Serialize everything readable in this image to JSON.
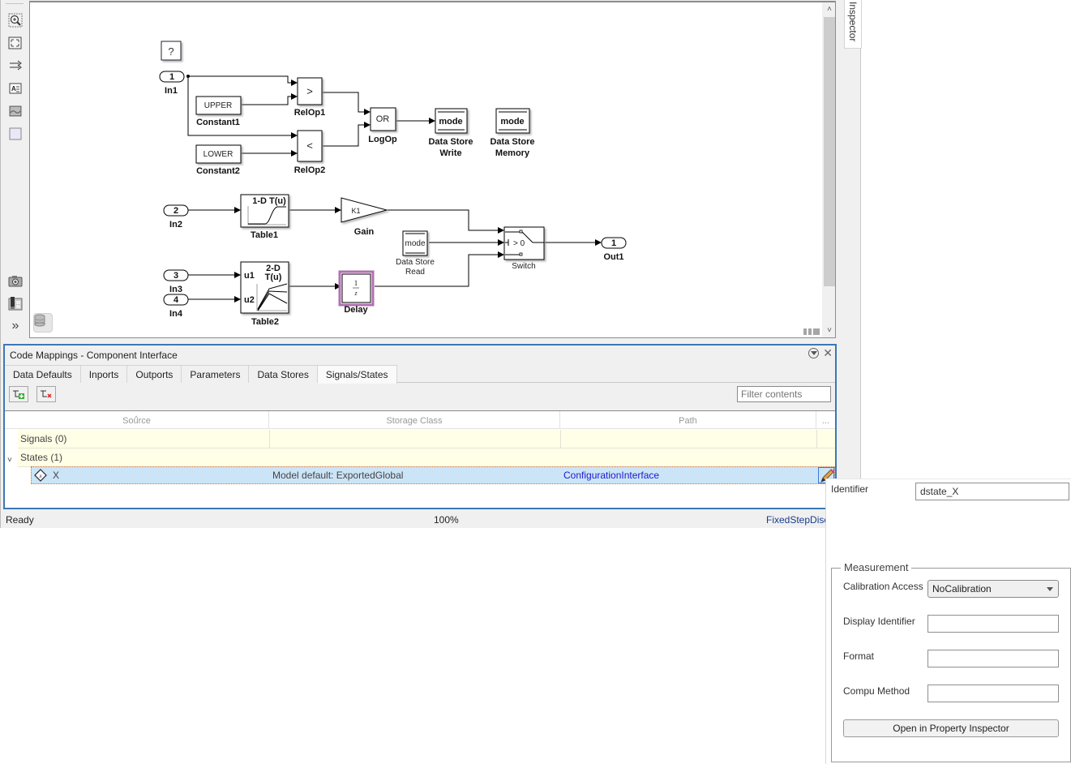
{
  "canvas": {
    "blocks": {
      "help": "?",
      "in1": {
        "num": "1",
        "label": "In1"
      },
      "in2": {
        "num": "2",
        "label": "In2"
      },
      "in3": {
        "num": "3",
        "label": "In3"
      },
      "in4": {
        "num": "4",
        "label": "In4"
      },
      "constant1": {
        "value": "UPPER",
        "label": "Constant1"
      },
      "constant2": {
        "value": "LOWER",
        "label": "Constant2"
      },
      "relop1": {
        "op": ">",
        "label": "RelOp1"
      },
      "relop2": {
        "op": "<",
        "label": "RelOp2"
      },
      "logop": {
        "op": "OR",
        "label": "LogOp"
      },
      "ds_write": {
        "name": "mode",
        "label_line1": "Data Store",
        "label_line2": "Write"
      },
      "ds_memory": {
        "name": "mode",
        "label_line1": "Data Store",
        "label_line2": "Memory"
      },
      "table1": {
        "title": "1-D T(u)",
        "label": "Table1"
      },
      "gain": {
        "value": "K1",
        "label": "Gain"
      },
      "ds_read": {
        "name": "mode",
        "label_line1": "Data Store",
        "label_line2": "Read"
      },
      "switch": {
        "criteria": "> 0",
        "label": "Switch"
      },
      "out1": {
        "num": "1",
        "label": "Out1"
      },
      "table2": {
        "title_line1": "2-D",
        "title_line2": "T(u)",
        "port1": "u1",
        "port2": "u2",
        "label": "Table2"
      },
      "delay": {
        "num": "1",
        "den": "z",
        "label": "Delay"
      }
    }
  },
  "inspector_tab": "Inspector",
  "code_mappings": {
    "title": "Code Mappings - Component Interface",
    "tabs": [
      "Data Defaults",
      "Inports",
      "Outports",
      "Parameters",
      "Data Stores",
      "Signals/States"
    ],
    "active_tab": "Signals/States",
    "filter_placeholder": "Filter contents",
    "columns": [
      "Source",
      "Storage Class",
      "Path",
      "..."
    ],
    "groups": [
      {
        "label": "Signals (0)"
      },
      {
        "label": "States (1)"
      }
    ],
    "rows": [
      {
        "source": "X",
        "storage_class": "Model default: ExportedGlobal",
        "path": "ConfigurationInterface"
      }
    ]
  },
  "status_bar": {
    "left": "Ready",
    "zoom": "100%",
    "solver": "FixedStepDisc"
  },
  "popup": {
    "identifier_label": "Identifier",
    "identifier_value": "dstate_X",
    "measurement_legend": "Measurement",
    "calibration_access_label": "Calibration Access",
    "calibration_access_value": "NoCalibration",
    "display_identifier_label": "Display Identifier",
    "display_identifier_value": "",
    "format_label": "Format",
    "format_value": "",
    "compu_method_label": "Compu Method",
    "compu_method_value": "",
    "open_button": "Open in Property Inspector"
  },
  "colors": {
    "panel_border": "#3b78b6",
    "selected_row": "#cce4f7",
    "group_row": "#fffee6",
    "link": "#1a1acc",
    "delay_highlight": "#b070b0"
  }
}
